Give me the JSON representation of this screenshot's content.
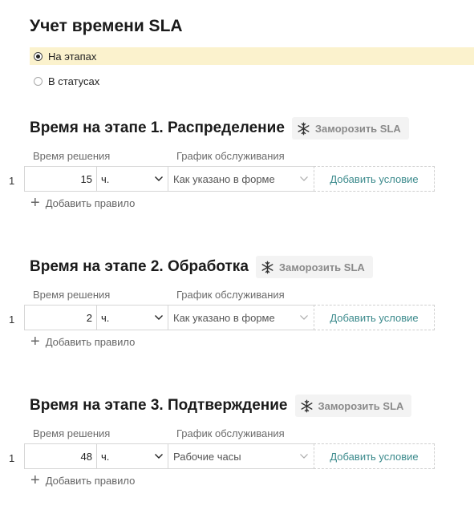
{
  "page": {
    "title": "Учет времени SLA"
  },
  "mode": {
    "options": [
      {
        "label": "На этапах",
        "selected": true
      },
      {
        "label": "В статусах",
        "selected": false
      }
    ]
  },
  "stages": [
    {
      "title": "Время на этапе 1. Распределение",
      "freeze_label": "Заморозить SLA",
      "col_time": "Время решения",
      "col_schedule": "График обслуживания",
      "rows": [
        {
          "num": "1",
          "hours": "15",
          "unit": "ч.",
          "schedule": "Как указано в форме",
          "add_condition": "Добавить условие"
        }
      ],
      "add_rule": "Добавить правило"
    },
    {
      "title": "Время на этапе 2. Обработка",
      "freeze_label": "Заморозить SLA",
      "col_time": "Время решения",
      "col_schedule": "График обслуживания",
      "rows": [
        {
          "num": "1",
          "hours": "2",
          "unit": "ч.",
          "schedule": "Как указано в форме",
          "add_condition": "Добавить условие"
        }
      ],
      "add_rule": "Добавить правило"
    },
    {
      "title": "Время на этапе 3. Подтверждение",
      "freeze_label": "Заморозить SLA",
      "col_time": "Время решения",
      "col_schedule": "График обслуживания",
      "rows": [
        {
          "num": "1",
          "hours": "48",
          "unit": "ч.",
          "schedule": "Рабочие часы",
          "add_condition": "Добавить условие"
        }
      ],
      "add_rule": "Добавить правило"
    }
  ],
  "icons": {
    "freeze": "snowflake-icon",
    "unit_dropdown": "chevron-down-icon",
    "schedule_dropdown": "chevron-down-icon",
    "add_rule": "plus-icon"
  },
  "colors": {
    "selected_highlight": "#fbf2cd",
    "link_teal": "#3b8a8c",
    "muted_gray": "#8a8a8a"
  }
}
